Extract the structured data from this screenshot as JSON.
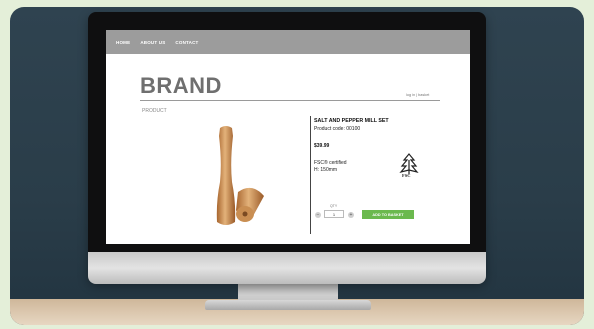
{
  "nav": {
    "items": [
      "HOME",
      "ABOUT US",
      "CONTACT"
    ]
  },
  "header": {
    "brand": "BRAND",
    "login_link": "log in | basket"
  },
  "page": {
    "section_label": "PRODUCT"
  },
  "product": {
    "title": "SALT AND PEPPER MILL SET",
    "code": "Product code: 00100",
    "price": "$39.99",
    "certification": "FSC® certified",
    "height": "H: 150mm",
    "image_name": "wooden salt and pepper mills"
  },
  "certification_logo": {
    "text": "FSC"
  },
  "cart": {
    "qty_label": "QTY",
    "qty_value": "1",
    "minus": "−",
    "plus": "+",
    "add_button": "ADD TO BASKET"
  },
  "colors": {
    "background": "#2f4350",
    "nav_bar": "#9c9c9c",
    "brand_text": "#6f6f6f",
    "add_button": "#6bb94e"
  }
}
